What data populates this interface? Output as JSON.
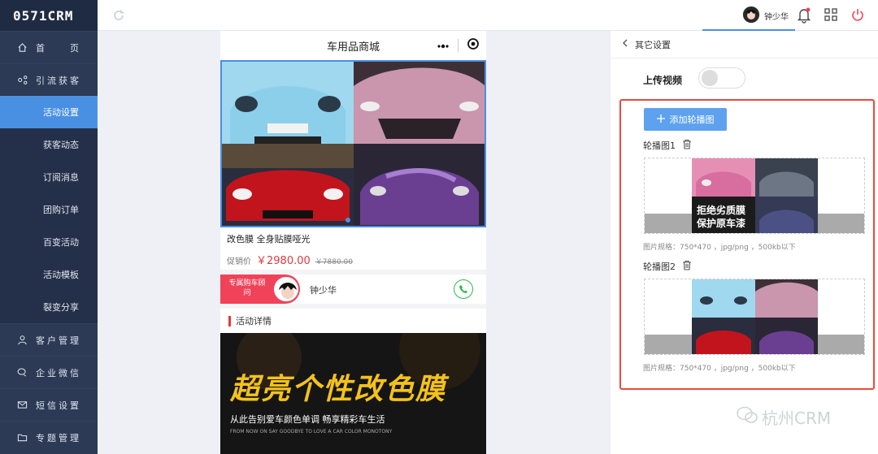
{
  "app": {
    "logo": "0571CRM"
  },
  "sidebar": {
    "items": [
      {
        "icon": "home-icon",
        "label": "首　　页"
      },
      {
        "icon": "share-icon",
        "label": "引流获客"
      }
    ],
    "subitems": [
      {
        "label": "活动设置",
        "active": true
      },
      {
        "label": "获客动态"
      },
      {
        "label": "订阅消息"
      },
      {
        "label": "团购订单"
      },
      {
        "label": "百变活动"
      },
      {
        "label": "活动模板"
      },
      {
        "label": "裂变分享"
      }
    ],
    "bottom_items": [
      {
        "icon": "user-icon",
        "label": "客户管理"
      },
      {
        "icon": "wechat-icon",
        "label": "企业微信"
      },
      {
        "icon": "mail-icon",
        "label": "短信设置"
      },
      {
        "icon": "folder-icon",
        "label": "专题管理"
      }
    ]
  },
  "topbar": {
    "user_name": "钟少华"
  },
  "phone": {
    "title": "车用品商城",
    "product_title": "改色膜 全身贴膜哑光",
    "price_label": "促销价",
    "price": "￥2980.00",
    "old_price": "￥7880.00",
    "advisor_tag": "专属购车顾问",
    "advisor_name": "钟少华",
    "detail_title": "活动详情",
    "banner_title": "超亮个性改色膜",
    "banner_sub": "从此告别爱车颜色单调  畅享精彩车生活",
    "banner_tiny": "FROM NOW ON SAY GOODBYE TO LOVE A CAR COLOR MONOTONY"
  },
  "panel": {
    "back_label": "其它设置",
    "upload_video_label": "上传视频",
    "upload_video_on": false,
    "add_button": "添加轮播图",
    "slides": [
      {
        "label": "轮播图1",
        "img_text_1": "拒绝劣质膜",
        "img_text_2": "保护原车漆",
        "spec": "图片规格：750*470 ，jpg/png ，500kb以下"
      },
      {
        "label": "轮播图2",
        "spec": "图片规格：750*470 ，jpg/png ，500kb以下"
      }
    ]
  },
  "watermark": "杭州CRM",
  "colors": {
    "sidebar": "#2c3a55",
    "accent": "#4a90e2",
    "price": "#e4393c",
    "highlight_box": "#e84a3c"
  }
}
